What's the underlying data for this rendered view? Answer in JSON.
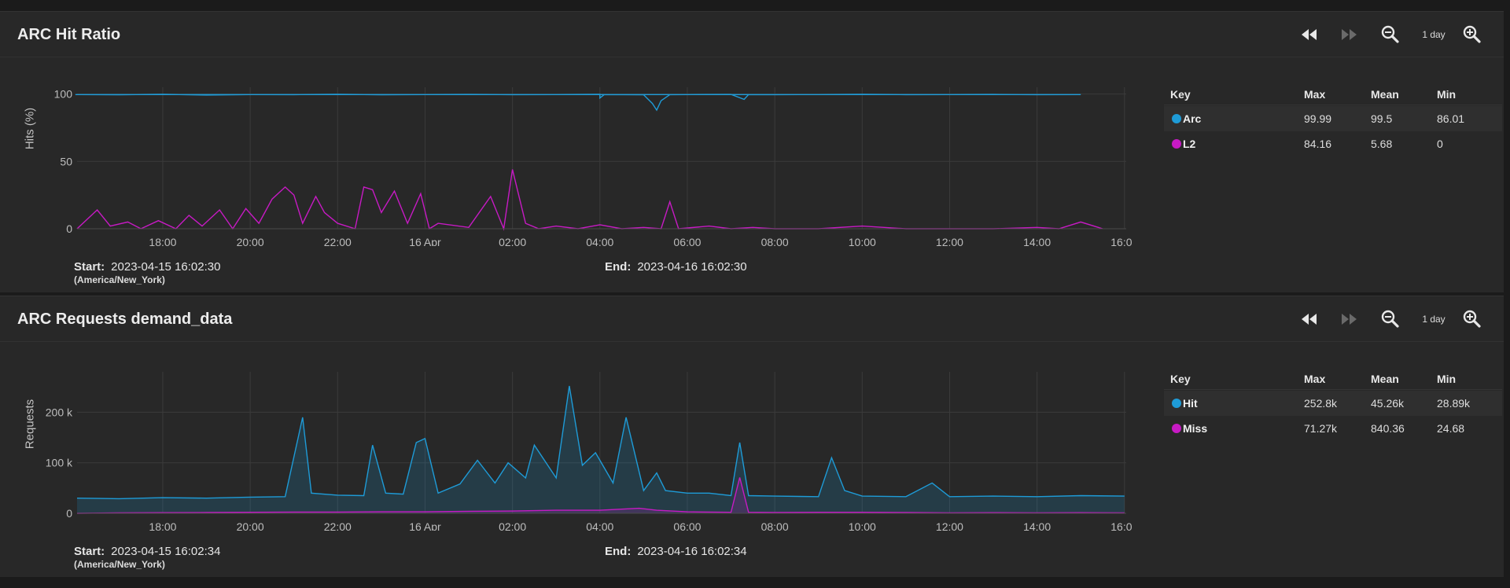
{
  "colors": {
    "series_a": "#1e9bd7",
    "series_b": "#c71ac4",
    "grid": "#3c3c3c"
  },
  "panels": [
    {
      "title": "ARC Hit Ratio",
      "toolbar": {
        "prev": "rewind-icon",
        "next": "fast-forward-icon",
        "zoom_out": "zoom-out-icon",
        "range_label": "1 day",
        "zoom_in": "zoom-in-icon"
      },
      "ylabel": "Hits (%)",
      "start_label": "Start:",
      "start": "2023-04-15 16:02:30",
      "timezone": "(America/New_York)",
      "end_label": "End:",
      "end": "2023-04-16 16:02:30",
      "legend": {
        "headers": [
          "Key",
          "Max",
          "Mean",
          "Min"
        ],
        "rows": [
          {
            "name": "Arc",
            "max": "99.99",
            "mean": "99.5",
            "min": "86.01"
          },
          {
            "name": "L2",
            "max": "84.16",
            "mean": "5.68",
            "min": "0"
          }
        ]
      }
    },
    {
      "title": "ARC Requests demand_data",
      "toolbar": {
        "prev": "rewind-icon",
        "next": "fast-forward-icon",
        "zoom_out": "zoom-out-icon",
        "range_label": "1 day",
        "zoom_in": "zoom-in-icon"
      },
      "ylabel": "Requests",
      "start_label": "Start:",
      "start": "2023-04-15 16:02:34",
      "timezone": "(America/New_York)",
      "end_label": "End:",
      "end": "2023-04-16 16:02:34",
      "legend": {
        "headers": [
          "Key",
          "Max",
          "Mean",
          "Min"
        ],
        "rows": [
          {
            "name": "Hit",
            "max": "252.8k",
            "mean": "45.26k",
            "min": "28.89k"
          },
          {
            "name": "Miss",
            "max": "71.27k",
            "mean": "840.36",
            "min": "24.68"
          }
        ]
      }
    }
  ],
  "chart_data": [
    {
      "type": "line",
      "x_ticks": [
        "18:00",
        "20:00",
        "22:00",
        "16 Apr",
        "02:00",
        "04:00",
        "06:00",
        "08:00",
        "10:00",
        "12:00",
        "14:00",
        "16:00"
      ],
      "y_ticks": [
        "100",
        "50",
        "0"
      ],
      "ylim": [
        0,
        105
      ],
      "ylabel": "Hits (%)",
      "grid": true,
      "x_start_hour": 16.04,
      "series": [
        {
          "name": "Arc",
          "color": "#1e9bd7",
          "points": [
            [
              16.04,
              99.6
            ],
            [
              17.0,
              99.4
            ],
            [
              18.0,
              99.8
            ],
            [
              19.0,
              99.2
            ],
            [
              20.0,
              99.6
            ],
            [
              21.0,
              99.5
            ],
            [
              22.0,
              99.8
            ],
            [
              23.0,
              99.4
            ],
            [
              0.0,
              99.6
            ],
            [
              1.0,
              99.7
            ],
            [
              2.0,
              99.5
            ],
            [
              3.0,
              99.6
            ],
            [
              4.0,
              99.8
            ],
            [
              4.0,
              97.0
            ],
            [
              4.1,
              99.6
            ],
            [
              5.0,
              99.4
            ],
            [
              5.2,
              93.0
            ],
            [
              5.3,
              88.0
            ],
            [
              5.4,
              95.0
            ],
            [
              5.6,
              99.5
            ],
            [
              6.0,
              99.6
            ],
            [
              7.0,
              99.7
            ],
            [
              7.3,
              96.0
            ],
            [
              7.4,
              99.6
            ],
            [
              8.0,
              99.5
            ],
            [
              9.0,
              99.6
            ],
            [
              10.0,
              99.8
            ],
            [
              11.0,
              99.5
            ],
            [
              12.0,
              99.6
            ],
            [
              13.0,
              99.7
            ],
            [
              14.0,
              99.5
            ],
            [
              15.0,
              99.6
            ],
            [
              16.0,
              99.6
            ]
          ]
        },
        {
          "name": "L2",
          "color": "#c71ac4",
          "points": [
            [
              16.04,
              0
            ],
            [
              16.5,
              14
            ],
            [
              16.8,
              2
            ],
            [
              17.2,
              5
            ],
            [
              17.5,
              0
            ],
            [
              17.9,
              6
            ],
            [
              18.3,
              0
            ],
            [
              18.6,
              10
            ],
            [
              18.9,
              2
            ],
            [
              19.3,
              14
            ],
            [
              19.6,
              0
            ],
            [
              19.9,
              15
            ],
            [
              20.2,
              4
            ],
            [
              20.5,
              22
            ],
            [
              20.8,
              31
            ],
            [
              21.0,
              25
            ],
            [
              21.2,
              4
            ],
            [
              21.5,
              24
            ],
            [
              21.7,
              12
            ],
            [
              22.0,
              4
            ],
            [
              22.4,
              0
            ],
            [
              22.6,
              31
            ],
            [
              22.8,
              29
            ],
            [
              23.0,
              12
            ],
            [
              23.3,
              28
            ],
            [
              23.6,
              4
            ],
            [
              23.9,
              26
            ],
            [
              24.1,
              0
            ],
            [
              24.3,
              4
            ],
            [
              25.0,
              1
            ],
            [
              25.5,
              24
            ],
            [
              25.8,
              0
            ],
            [
              26.0,
              44
            ],
            [
              26.3,
              4
            ],
            [
              26.6,
              0
            ],
            [
              27.0,
              2
            ],
            [
              27.5,
              0
            ],
            [
              28.0,
              3
            ],
            [
              28.5,
              0
            ],
            [
              29.0,
              1
            ],
            [
              29.4,
              0
            ],
            [
              29.6,
              20
            ],
            [
              29.8,
              0
            ],
            [
              30.5,
              2
            ],
            [
              31.0,
              0
            ],
            [
              31.5,
              1
            ],
            [
              32.0,
              0
            ],
            [
              33.0,
              0
            ],
            [
              34.0,
              2
            ],
            [
              35.0,
              0
            ],
            [
              36.0,
              0
            ],
            [
              37.0,
              0
            ],
            [
              38.0,
              1
            ],
            [
              38.5,
              0
            ],
            [
              39.0,
              5
            ],
            [
              39.5,
              0
            ]
          ]
        }
      ]
    },
    {
      "type": "area",
      "x_ticks": [
        "18:00",
        "20:00",
        "22:00",
        "16 Apr",
        "02:00",
        "04:00",
        "06:00",
        "08:00",
        "10:00",
        "12:00",
        "14:00",
        "16:00"
      ],
      "y_ticks": [
        "200 k",
        "100 k",
        "0"
      ],
      "ylim": [
        0,
        280000
      ],
      "ylabel": "Requests",
      "grid": true,
      "series": [
        {
          "name": "Hit",
          "color": "#1e9bd7",
          "points": [
            [
              16.04,
              30000
            ],
            [
              17.0,
              29000
            ],
            [
              18.0,
              31000
            ],
            [
              19.0,
              30000
            ],
            [
              20.0,
              32000
            ],
            [
              20.8,
              33000
            ],
            [
              21.2,
              190000
            ],
            [
              21.4,
              40000
            ],
            [
              22.0,
              36000
            ],
            [
              22.6,
              35000
            ],
            [
              22.8,
              135000
            ],
            [
              23.1,
              40000
            ],
            [
              23.5,
              38000
            ],
            [
              23.8,
              140000
            ],
            [
              24.0,
              148000
            ],
            [
              24.3,
              40000
            ],
            [
              24.8,
              58000
            ],
            [
              25.2,
              105000
            ],
            [
              25.6,
              60000
            ],
            [
              25.9,
              100000
            ],
            [
              26.3,
              70000
            ],
            [
              26.5,
              135000
            ],
            [
              27.0,
              70000
            ],
            [
              27.3,
              252000
            ],
            [
              27.6,
              95000
            ],
            [
              27.9,
              120000
            ],
            [
              28.3,
              60000
            ],
            [
              28.6,
              190000
            ],
            [
              29.0,
              45000
            ],
            [
              29.3,
              80000
            ],
            [
              29.5,
              45000
            ],
            [
              30.0,
              40000
            ],
            [
              30.5,
              40000
            ],
            [
              31.0,
              35000
            ],
            [
              31.2,
              140000
            ],
            [
              31.4,
              35000
            ],
            [
              32.0,
              34000
            ],
            [
              33.0,
              33000
            ],
            [
              33.3,
              110000
            ],
            [
              33.6,
              45000
            ],
            [
              34.0,
              34000
            ],
            [
              35.0,
              33000
            ],
            [
              35.6,
              60000
            ],
            [
              36.0,
              33000
            ],
            [
              37.0,
              34000
            ],
            [
              38.0,
              33000
            ],
            [
              39.0,
              35000
            ],
            [
              40.0,
              34000
            ]
          ]
        },
        {
          "name": "Miss",
          "color": "#c71ac4",
          "points": [
            [
              16.04,
              0
            ],
            [
              17.0,
              1000
            ],
            [
              18.0,
              1200
            ],
            [
              19.0,
              1500
            ],
            [
              20.0,
              2000
            ],
            [
              21.0,
              2500
            ],
            [
              22.0,
              2500
            ],
            [
              23.0,
              3000
            ],
            [
              24.0,
              3000
            ],
            [
              25.0,
              4000
            ],
            [
              26.0,
              4500
            ],
            [
              27.0,
              6000
            ],
            [
              28.0,
              6000
            ],
            [
              28.9,
              10000
            ],
            [
              29.3,
              6000
            ],
            [
              30.0,
              3000
            ],
            [
              31.0,
              2000
            ],
            [
              31.2,
              71000
            ],
            [
              31.4,
              2000
            ],
            [
              32.0,
              1500
            ],
            [
              33.0,
              2000
            ],
            [
              34.0,
              2000
            ],
            [
              35.0,
              1500
            ],
            [
              36.0,
              1000
            ],
            [
              37.0,
              1200
            ],
            [
              38.0,
              1000
            ],
            [
              39.0,
              1200
            ],
            [
              40.0,
              1000
            ]
          ]
        }
      ]
    }
  ]
}
